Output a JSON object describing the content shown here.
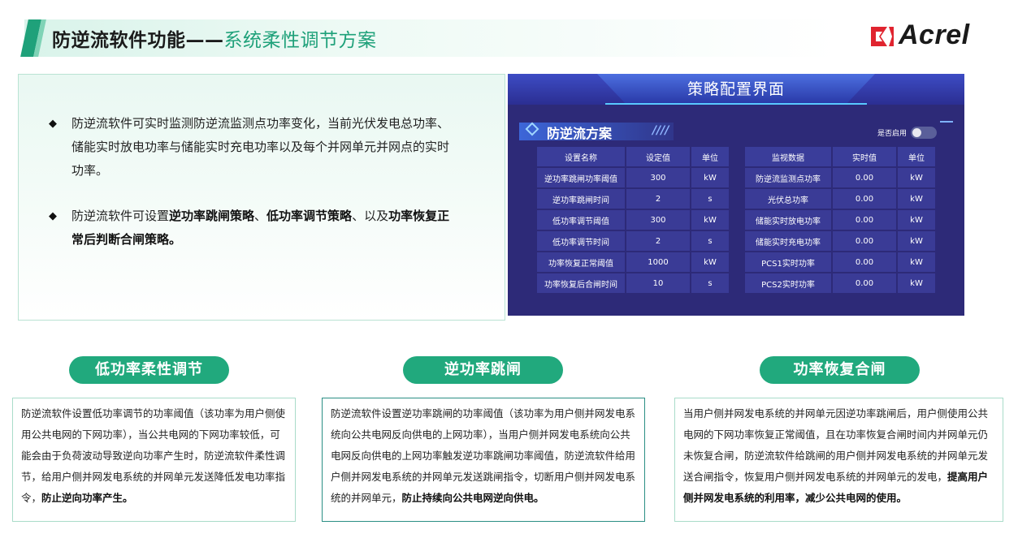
{
  "header": {
    "title_main": "防逆流软件功能——",
    "title_sub": "系统柔性调节方案"
  },
  "logo": {
    "text": "Acrel",
    "icon": "acrel-logo-icon",
    "color": "#e0242f"
  },
  "intro": {
    "bullet_icon": "◆",
    "bullet1": "防逆流软件可实时监测防逆流监测点功率变化，当前光伏发电总功率、储能实时放电功率与储能实时充电功率以及每个并网单元并网点的实时功率。",
    "bullet2_parts": [
      {
        "text": "防逆流软件可设置",
        "bold": false
      },
      {
        "text": "逆功率跳闸策略",
        "bold": true
      },
      {
        "text": "、",
        "bold": false
      },
      {
        "text": "低功率调节策略",
        "bold": true
      },
      {
        "text": "、以及",
        "bold": false
      },
      {
        "text": "功率恢复正常后判断合闸策略。",
        "bold": true
      }
    ]
  },
  "screen": {
    "title": "策略配置界面",
    "section_title": "防逆流方案",
    "section_decor": "////",
    "toggle_label": "是否启用",
    "toggle_on": false,
    "settings_table": {
      "headers": [
        "设置名称",
        "设定值",
        "单位"
      ],
      "rows": [
        [
          "逆功率跳闸功率阈值",
          "300",
          "kW"
        ],
        [
          "逆功率跳闸时间",
          "2",
          "s"
        ],
        [
          "低功率调节阈值",
          "300",
          "kW"
        ],
        [
          "低功率调节时间",
          "2",
          "s"
        ],
        [
          "功率恢复正常阈值",
          "1000",
          "kW"
        ],
        [
          "功率恢复后合闸时间",
          "10",
          "s"
        ]
      ]
    },
    "monitor_table": {
      "headers": [
        "监视数据",
        "实时值",
        "单位"
      ],
      "rows": [
        [
          "防逆流监测点功率",
          "0.00",
          "kW"
        ],
        [
          "光伏总功率",
          "0.00",
          "kW"
        ],
        [
          "储能实时放电功率",
          "0.00",
          "kW"
        ],
        [
          "储能实时充电功率",
          "0.00",
          "kW"
        ],
        [
          "PCS1实时功率",
          "0.00",
          "kW"
        ],
        [
          "PCS2实时功率",
          "0.00",
          "kW"
        ]
      ]
    }
  },
  "features": [
    {
      "label": "低功率柔性调节",
      "body": "防逆流软件设置低功率调节的功率阈值（该功率为用户侧使用公共电网的下网功率），当公共电网的下网功率较低，可能会由于负荷波动导致逆向功率产生时，防逆流软件柔性调节，给用户侧并网发电系统的并网单元发送降低发电功率指令，",
      "emphasis": "防止逆向功率产生。"
    },
    {
      "label": "逆功率跳闸",
      "body": "防逆流软件设置逆功率跳闸的功率阈值（该功率为用户侧并网发电系统向公共电网反向供电的上网功率），当用户侧并网发电系统向公共电网反向供电的上网功率触发逆功率跳闸功率阈值，防逆流软件给用户侧并网发电系统的并网单元发送跳闸指令，切断用户侧并网发电系统的并网单元，",
      "emphasis": "防止持续向公共电网逆向供电。"
    },
    {
      "label": "功率恢复合闸",
      "body": "当用户侧并网发电系统的并网单元因逆功率跳闸后，用户侧使用公共电网的下网功率恢复正常阈值，且在功率恢复合闸时间内并网单元仍未恢复合闸，防逆流软件给跳闸的用户侧并网发电系统的并网单元发送合闸指令，恢复用户侧并网发电系统的并网单元的发电，",
      "emphasis": "提高用户侧并网发电系统的利用率，减少公共电网的使用。"
    }
  ],
  "colors": {
    "accent_green": "#21a97d",
    "screen_bg": "#2d2a78",
    "screen_cell": "#3a3b96"
  }
}
